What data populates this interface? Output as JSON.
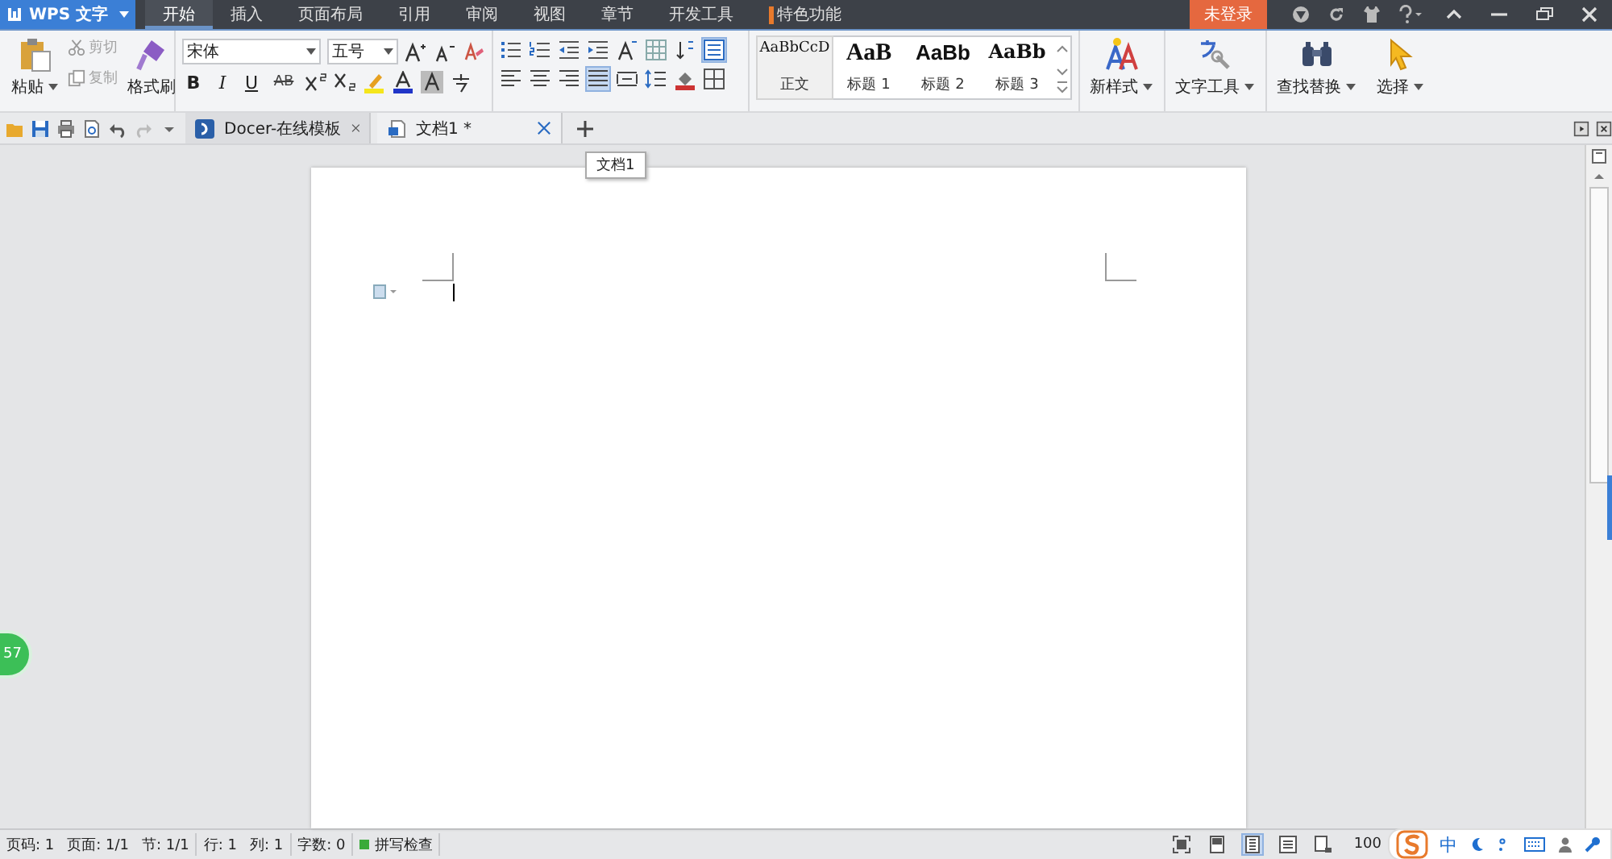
{
  "app_menu": {
    "label": "WPS 文字"
  },
  "menu_tabs": [
    {
      "label": "开始",
      "selected": true,
      "kind": "plain"
    },
    {
      "label": "插入",
      "selected": false,
      "kind": "plain"
    },
    {
      "label": "页面布局",
      "selected": false,
      "kind": "plain"
    },
    {
      "label": "引用",
      "selected": false,
      "kind": "plain"
    },
    {
      "label": "审阅",
      "selected": false,
      "kind": "plain"
    },
    {
      "label": "视图",
      "selected": false,
      "kind": "plain"
    },
    {
      "label": "章节",
      "selected": false,
      "kind": "plain"
    },
    {
      "label": "开发工具",
      "selected": false,
      "kind": "plain"
    },
    {
      "label": "特色功能",
      "selected": false,
      "kind": "marked"
    }
  ],
  "login_button": "未登录",
  "clipboard": {
    "paste": "粘贴",
    "format_painter": "格式刷",
    "items": [
      {
        "label": "剪切",
        "disabled": true,
        "kind": "cut"
      },
      {
        "label": "复制",
        "disabled": true,
        "kind": "copy"
      }
    ]
  },
  "font": {
    "family": "宋体",
    "size": "五号"
  },
  "format_buttons": [
    {
      "label": "B",
      "kind": "bold"
    },
    {
      "label": "I",
      "kind": "italic"
    },
    {
      "label": "U",
      "kind": "underline"
    },
    {
      "label": "AB",
      "kind": "strike"
    }
  ],
  "alignment": [
    {
      "selected": false
    },
    {
      "selected": false
    },
    {
      "selected": false
    },
    {
      "selected": true
    },
    {
      "selected": false
    }
  ],
  "styles": [
    {
      "sample": "AaBbCcD",
      "label": "正文",
      "selected": true,
      "kind": "normal"
    },
    {
      "sample": "AaB",
      "label": "标题 1",
      "selected": false,
      "kind": "h1"
    },
    {
      "sample": "AaBb",
      "label": "标题 2",
      "selected": false,
      "kind": "h2"
    },
    {
      "sample": "AaBb",
      "label": "标题 3",
      "selected": false,
      "kind": "h3"
    }
  ],
  "big_buttons": [
    {
      "label": "新样式",
      "kind": "new-style"
    },
    {
      "label": "文字工具",
      "kind": "text-tools"
    },
    {
      "label": "查找替换",
      "kind": "find"
    },
    {
      "label": "选择",
      "kind": "select"
    }
  ],
  "doc_tabs": [
    {
      "label": "Docer-在线模板",
      "selected": false,
      "kind": "docer"
    },
    {
      "label": "文档1 *",
      "selected": true,
      "kind": "doc"
    }
  ],
  "tooltip": "文档1",
  "float_badge": "57",
  "status_groups": [
    [
      "页码: 1",
      "页面: 1/1",
      "节: 1/1"
    ],
    [
      "行: 1",
      "列: 1"
    ],
    [
      "字数: 0"
    ]
  ],
  "spell_check": {
    "label": "拼写检查",
    "on": true
  },
  "view_modes": [
    {
      "selected": false
    },
    {
      "selected": true
    },
    {
      "selected": false
    },
    {
      "selected": false
    }
  ],
  "zoom": "100",
  "ime": {
    "mode": "中"
  }
}
